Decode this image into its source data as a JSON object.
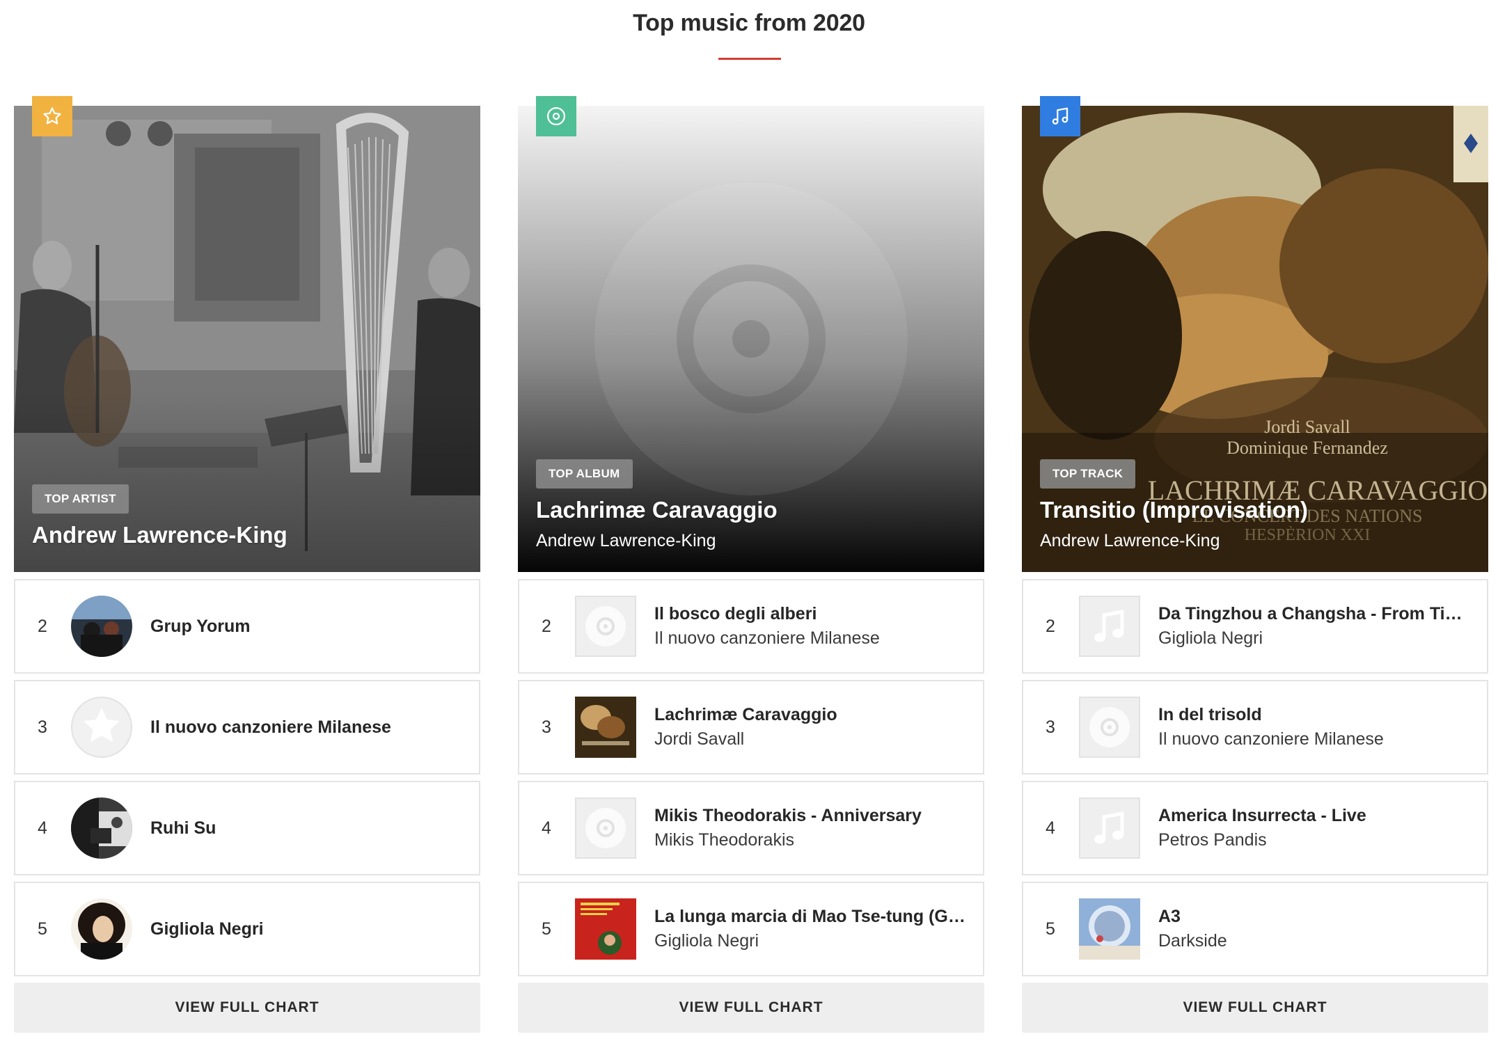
{
  "page": {
    "title": "Top music from 2020"
  },
  "columns": [
    {
      "badge_icon": "star-icon",
      "badge_color": "#f2b240",
      "hero_label": "TOP ARTIST",
      "hero_title": "Andrew Lawrence-King",
      "hero_subtitle": "",
      "items": [
        {
          "rank": "2",
          "title": "Grup Yorum",
          "subtitle": "",
          "thumb": "artist-photo"
        },
        {
          "rank": "3",
          "title": "Il nuovo canzoniere Milanese",
          "subtitle": "",
          "thumb": "star-placeholder-icon"
        },
        {
          "rank": "4",
          "title": "Ruhi Su",
          "subtitle": "",
          "thumb": "artist-photo"
        },
        {
          "rank": "5",
          "title": "Gigliola Negri",
          "subtitle": "",
          "thumb": "artist-photo"
        }
      ],
      "button_label": "VIEW FULL CHART"
    },
    {
      "badge_icon": "disc-icon",
      "badge_color": "#4fbf95",
      "hero_label": "TOP ALBUM",
      "hero_title": "Lachrimæ Caravaggio",
      "hero_subtitle": "Andrew Lawrence-King",
      "items": [
        {
          "rank": "2",
          "title": "Il bosco degli alberi",
          "subtitle": "Il nuovo canzoniere Milanese",
          "thumb": "disc-placeholder-icon"
        },
        {
          "rank": "3",
          "title": "Lachrimæ Caravaggio",
          "subtitle": "Jordi Savall",
          "thumb": "album-cover"
        },
        {
          "rank": "4",
          "title": "Mikis Theodorakis - Anniversary",
          "subtitle": "Mikis Theodorakis",
          "thumb": "disc-placeholder-icon"
        },
        {
          "rank": "5",
          "title": "La lunga marcia di Mao Tse-tung (Gigliola Negri)",
          "subtitle": "Gigliola Negri",
          "thumb": "album-cover"
        }
      ],
      "button_label": "VIEW FULL CHART"
    },
    {
      "badge_icon": "music-note-icon",
      "badge_color": "#2f7de1",
      "hero_label": "TOP TRACK",
      "hero_title": "Transitio (Improvisation)",
      "hero_subtitle": "Andrew Lawrence-King",
      "items": [
        {
          "rank": "2",
          "title": "Da Tingzhou a Changsha - From Tingzhou to Changsha",
          "subtitle": "Gigliola Negri",
          "thumb": "note-placeholder-icon"
        },
        {
          "rank": "3",
          "title": "In del trisold",
          "subtitle": "Il nuovo canzoniere Milanese",
          "thumb": "disc-placeholder-icon"
        },
        {
          "rank": "4",
          "title": "America Insurrecta - Live",
          "subtitle": "Petros Pandis",
          "thumb": "note-placeholder-icon"
        },
        {
          "rank": "5",
          "title": "A3",
          "subtitle": "Darkside",
          "thumb": "album-cover"
        }
      ],
      "button_label": "VIEW FULL CHART"
    }
  ],
  "hero_cover_text": {
    "line1": "Jordi Savall",
    "line2": "Dominique Fernandez",
    "line3": "LACHRIMÆ CARAVAGGIO",
    "line4": "LE CONCERT DES NATIONS",
    "line5": "HESPÈRION XXI"
  },
  "colors": {
    "accent_rule": "#d33b31",
    "row_border": "#e4e4e4",
    "button_bg": "#eeeeee"
  }
}
